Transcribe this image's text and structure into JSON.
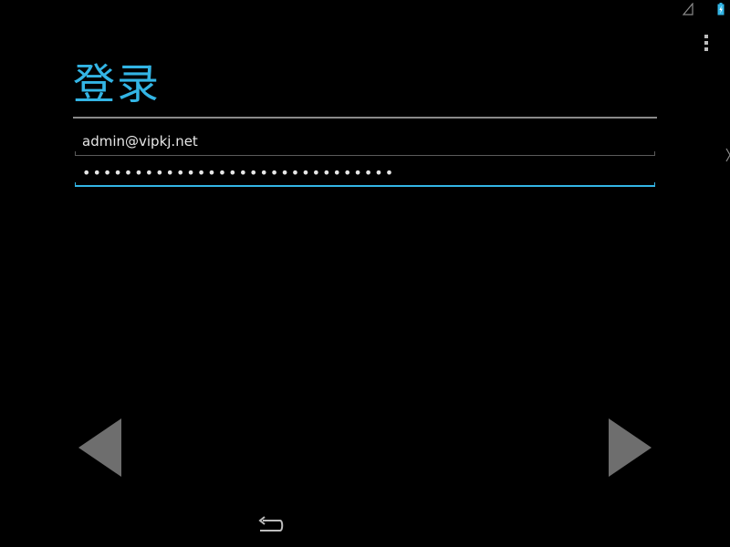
{
  "app": {
    "title": "登录",
    "accent_color": "#33b5e5"
  },
  "status_bar": {
    "signal_icon": "signal-empty-icon",
    "battery_icon": "battery-charging-icon",
    "battery_color": "#33b5e5"
  },
  "action_bar": {
    "overflow_icon": "overflow-menu-icon"
  },
  "form": {
    "email": {
      "value": "admin@vipkj.net",
      "placeholder": ""
    },
    "password": {
      "value": "••••••••••••••••••••••••••••••",
      "placeholder": "",
      "focused": true,
      "focus_color": "#33b5e5"
    }
  },
  "navigation": {
    "prev_icon": "arrow-left-icon",
    "next_icon": "arrow-right-icon",
    "back_icon": "back-icon"
  }
}
